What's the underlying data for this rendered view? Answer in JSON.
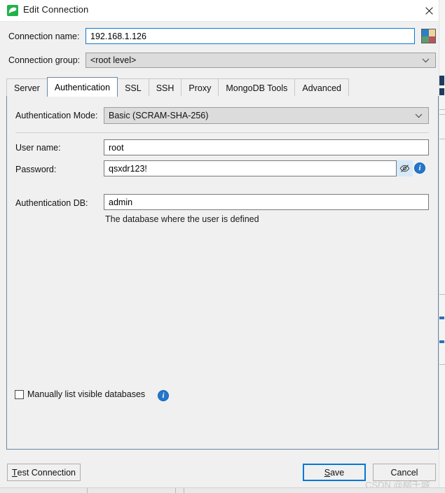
{
  "window": {
    "title": "Edit Connection",
    "icon": "leaf-icon",
    "close_label": "×"
  },
  "top_form": {
    "connection_name_label": "Connection name:",
    "connection_name_value": "192.168.1.126",
    "connection_group_label": "Connection group:",
    "connection_group_value": "<root level>",
    "color_swatch": {
      "name": "color-swatch-button",
      "colors": [
        "#2b7fc4",
        "#f2d49a",
        "#5d9b6e",
        "#b8555c"
      ]
    }
  },
  "tabs": [
    {
      "label": "Server",
      "active": false
    },
    {
      "label": "Authentication",
      "active": true
    },
    {
      "label": "SSL",
      "active": false
    },
    {
      "label": "SSH",
      "active": false
    },
    {
      "label": "Proxy",
      "active": false
    },
    {
      "label": "MongoDB Tools",
      "active": false
    },
    {
      "label": "Advanced",
      "active": false
    }
  ],
  "authentication": {
    "mode_label": "Authentication Mode:",
    "mode_value": "Basic (SCRAM-SHA-256)",
    "username_label": "User name:",
    "username_value": "root",
    "password_label": "Password:",
    "password_value": "qsxdr123!",
    "password_reveal_icon": "eye-slash-icon",
    "password_info_icon": "info-icon",
    "password_info_glyph": "i",
    "authdb_label": "Authentication DB:",
    "authdb_value": "admin",
    "authdb_hint": "The database where the user is defined"
  },
  "options": {
    "manually_list_label": "Manually list visible databases",
    "manually_list_checked": false,
    "manually_list_info_glyph": "i"
  },
  "footer": {
    "test_connection_mnemonic": "T",
    "test_connection_rest": "est Connection",
    "save_mnemonic": "S",
    "save_rest": "ave",
    "cancel_label": "Cancel"
  },
  "watermark": {
    "text": "CSDN @柳千城"
  },
  "colors": {
    "accent": "#0078d7",
    "dialog_bg": "#f0f0f0",
    "panel_border": "#6d86a3",
    "icon_green": "#22b24c",
    "info_blue": "#2277cc"
  }
}
